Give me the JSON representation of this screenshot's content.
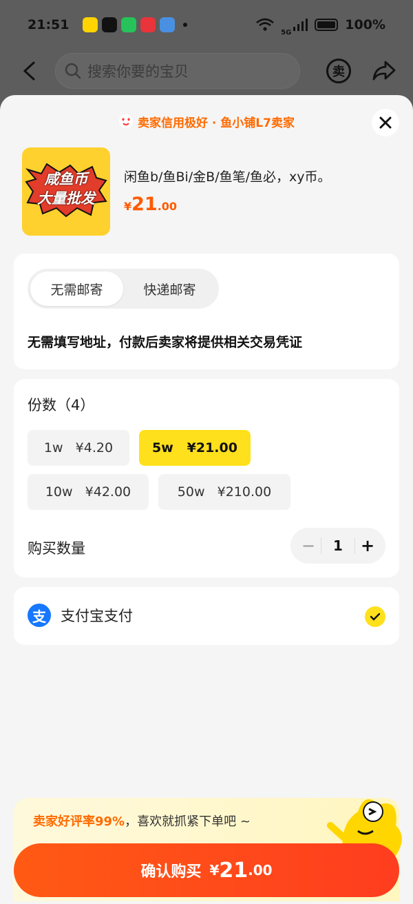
{
  "status": {
    "time": "21:51",
    "network": "5G",
    "battery": "100%",
    "battery_level": 1.0
  },
  "nav": {
    "search_placeholder": "搜索你要的宝贝",
    "sell_icon_text": "卖"
  },
  "sheet": {
    "seller_tag": "卖家信用极好 · 鱼小铺L7卖家",
    "product": {
      "thumb_line1": "咸鱼币",
      "thumb_line2": "大量批发",
      "title": "闲鱼b/鱼Bi/金B/鱼笔/鱼必，xy币。",
      "price_currency": "¥",
      "price_int": "21",
      "price_dec": ".00"
    },
    "shipping": {
      "tabs": [
        "无需邮寄",
        "快递邮寄"
      ],
      "active_tab": 0,
      "note": "无需填写地址，付款后卖家将提供相关交易凭证"
    },
    "options": {
      "title": "份数（4）",
      "items": [
        "1w   ¥4.20",
        "5w   ¥21.00",
        "10w   ¥42.00",
        "50w   ¥210.00"
      ],
      "selected": 1
    },
    "quantity": {
      "label": "购买数量",
      "minus": "−",
      "value": "1",
      "plus": "+"
    },
    "payment": {
      "icon_char": "支",
      "label": "支付宝支付"
    },
    "promo": {
      "strong": "卖家好评率99%",
      "rest": "，喜欢就抓紧下单吧 ~"
    },
    "confirm": {
      "label": "确认购买",
      "currency": "¥",
      "int": "21",
      "dec": ".00"
    }
  },
  "colors": {
    "accent_yellow": "#ffe01c",
    "accent_orange": "#ff5a00",
    "alipay_blue": "#1677ff"
  }
}
